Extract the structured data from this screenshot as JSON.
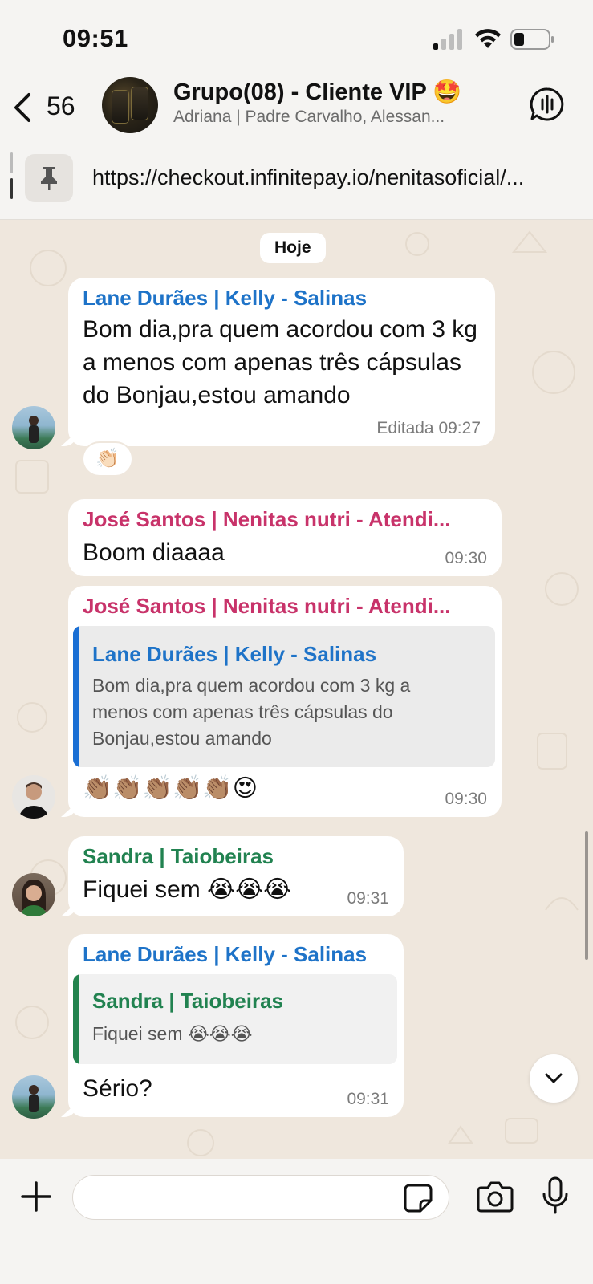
{
  "status": {
    "time": "09:51"
  },
  "header": {
    "back_count": "56",
    "title": "Grupo(08) - Cliente VIP 🤩",
    "subtitle": "Adriana | Padre Carvalho, Alessan..."
  },
  "pinned": {
    "link": "https://checkout.infinitepay.io/nenitasoficial/..."
  },
  "date_chip": "Hoje",
  "colors": {
    "blue_sender": "#1e73c8",
    "pink_sender": "#c8336a",
    "green_sender": "#218250",
    "quote_bar_blue": "#1a6fd4",
    "quote_bar_green": "#23834d"
  },
  "messages": [
    {
      "sender": "Lane Durães | Kelly - Salinas",
      "text": "Bom dia,pra quem acordou com 3 kg a menos com apenas três cápsulas do Bonjau,estou amando",
      "time": "Editada 09:27",
      "reaction": "👏🏻"
    },
    {
      "sender": "José Santos | Nenitas nutri - Atendi...",
      "text": "Boom diaaaa",
      "time": "09:30"
    },
    {
      "sender": "José Santos | Nenitas nutri - Atendi...",
      "quote": {
        "name": "Lane Durães | Kelly - Salinas",
        "text": "Bom dia,pra quem acordou com 3 kg a menos com apenas três cápsulas do Bonjau,estou amando"
      },
      "text": "👏🏽👏🏽👏🏽👏🏽👏🏽😍",
      "time": "09:30"
    },
    {
      "sender": "Sandra | Taiobeiras",
      "text": "Fiquei sem 😭😭😭",
      "time": "09:31"
    },
    {
      "sender": "Lane Durães | Kelly - Salinas",
      "quote": {
        "name": "Sandra | Taiobeiras",
        "text": "Fiquei sem 😭😭😭"
      },
      "text": "Sério?",
      "time": "09:31"
    }
  ]
}
